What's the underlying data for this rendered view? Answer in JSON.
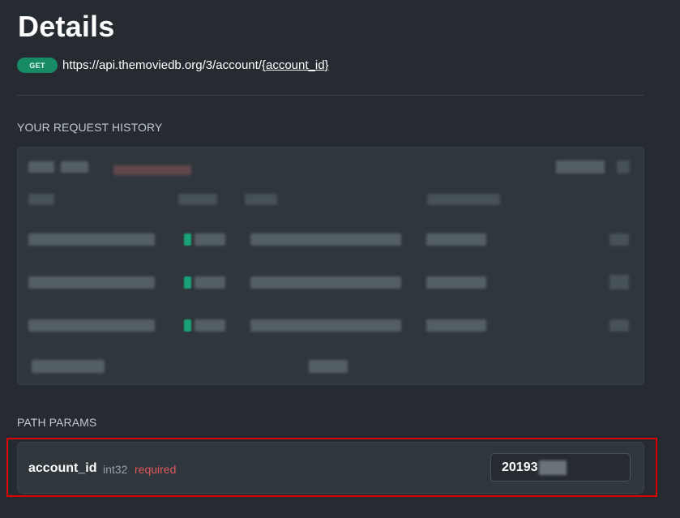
{
  "page": {
    "title": "Details"
  },
  "endpoint": {
    "method": "GET",
    "url_base": "https://api.themoviedb.org/3/account/",
    "url_param": "{account_id}"
  },
  "history": {
    "section_label": "YOUR REQUEST HISTORY",
    "content_obscured": true,
    "visible_rows": 3
  },
  "path_params": {
    "section_label": "PATH PARAMS",
    "params": [
      {
        "name": "account_id",
        "type": "int32",
        "required_label": "required",
        "value_visible": "20193"
      }
    ]
  },
  "colors": {
    "background": "#262b31",
    "panel": "#2f373c",
    "get_badge": "#178a66",
    "required": "#e0595d",
    "highlight_border": "#e00000",
    "status_ok": "#1aa278"
  }
}
